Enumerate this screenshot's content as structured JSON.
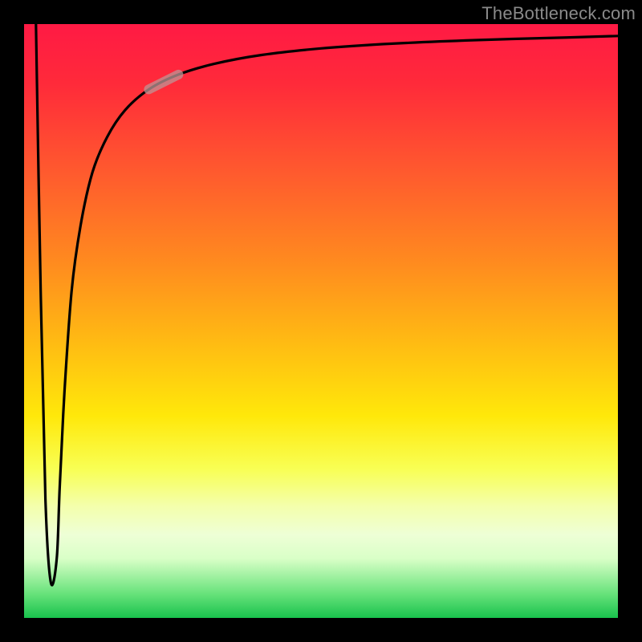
{
  "watermark": "TheBottleneck.com",
  "colors": {
    "frame": "#000000",
    "curve": "#000000",
    "highlight": "rgba(190,150,150,0.75)",
    "watermark": "#8a8a8a"
  },
  "chart_data": {
    "type": "line",
    "title": "",
    "xlabel": "",
    "ylabel": "",
    "xlim": [
      0,
      100
    ],
    "ylim": [
      0,
      100
    ],
    "grid": false,
    "legend": false,
    "annotations": [],
    "background_gradient": {
      "orientation": "vertical",
      "top_color": "#ff1a44",
      "bottom_color": "#19c24d"
    },
    "series": [
      {
        "name": "bottleneck-curve",
        "x": [
          2.0,
          2.8,
          3.6,
          4.5,
          5.5,
          6.0,
          6.8,
          8.0,
          9.5,
          11.5,
          14.0,
          17.0,
          21.0,
          26.0,
          32.0,
          40.0,
          50.0,
          62.0,
          76.0,
          90.0,
          100.0
        ],
        "y": [
          100.0,
          55.0,
          20.0,
          6.0,
          10.0,
          22.0,
          38.0,
          55.0,
          66.0,
          75.0,
          81.0,
          85.5,
          89.0,
          91.5,
          93.3,
          94.8,
          95.9,
          96.7,
          97.3,
          97.7,
          98.0
        ]
      }
    ],
    "highlight_segment": {
      "series": "bottleneck-curve",
      "x_start": 21.0,
      "x_end": 28.0
    }
  }
}
